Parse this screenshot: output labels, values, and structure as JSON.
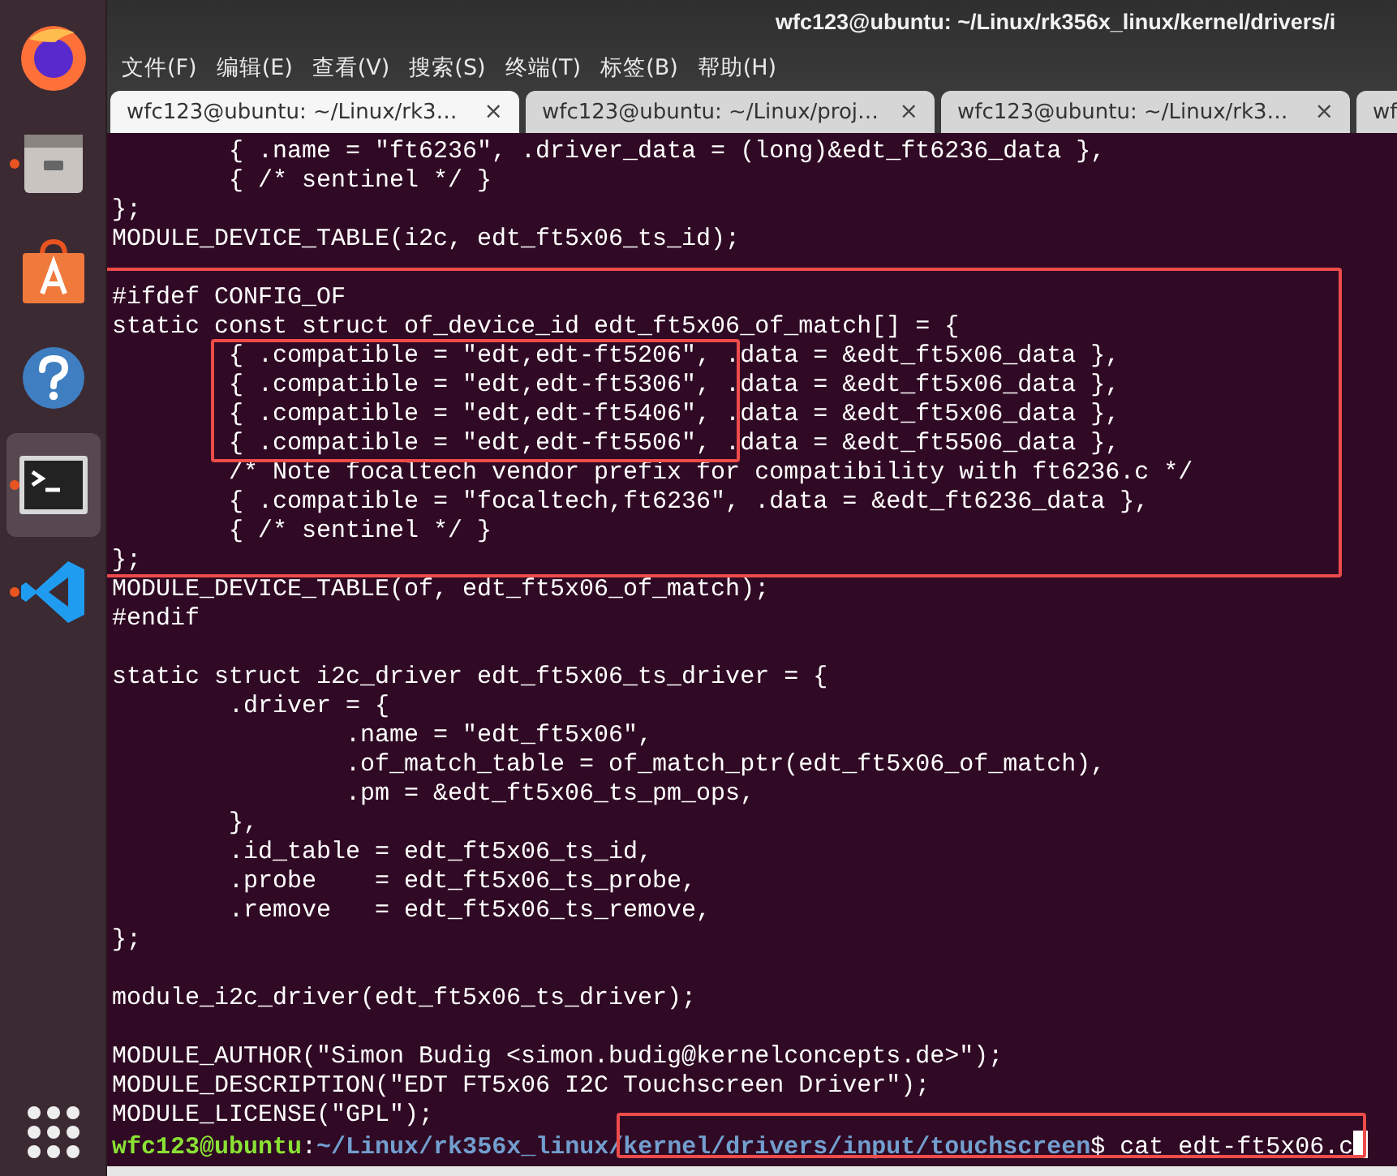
{
  "dock": {
    "items": [
      {
        "kind": "firefox",
        "running": false,
        "selected": false
      },
      {
        "kind": "files",
        "running": true,
        "selected": false
      },
      {
        "kind": "store",
        "running": false,
        "selected": false
      },
      {
        "kind": "help",
        "running": false,
        "selected": false
      },
      {
        "kind": "terminal",
        "running": true,
        "selected": true
      },
      {
        "kind": "vscode",
        "running": true,
        "selected": false
      }
    ]
  },
  "window": {
    "title": "wfc123@ubuntu: ~/Linux/rk356x_linux/kernel/drivers/i"
  },
  "menu": [
    "文件(F)",
    "编辑(E)",
    "查看(V)",
    "搜索(S)",
    "终端(T)",
    "标签(B)",
    "帮助(H)"
  ],
  "tabs": [
    {
      "label": "wfc123@ubuntu: ~/Linux/rk3…",
      "selected": true,
      "close": "×"
    },
    {
      "label": "wfc123@ubuntu: ~/Linux/proj…",
      "selected": false,
      "close": "×"
    },
    {
      "label": "wfc123@ubuntu: ~/Linux/rk3…",
      "selected": false,
      "close": "×"
    },
    {
      "label": "wf",
      "selected": false
    }
  ],
  "terminal": {
    "lines": [
      {
        "text": "        { .name = \"ft6236\", .driver_data = (long)&edt_ft6236_data },"
      },
      {
        "text": "        { /* sentinel */ }"
      },
      {
        "text": "};"
      },
      {
        "text": "MODULE_DEVICE_TABLE(i2c, edt_ft5x06_ts_id);"
      },
      {
        "kind": "blank"
      },
      {
        "text": "#ifdef CONFIG_OF"
      },
      {
        "text": "static const struct of_device_id edt_ft5x06_of_match[] = {"
      },
      {
        "text": "        { .compatible = \"edt,edt-ft5206\", .data = &edt_ft5x06_data },"
      },
      {
        "text": "        { .compatible = \"edt,edt-ft5306\", .data = &edt_ft5x06_data },"
      },
      {
        "text": "        { .compatible = \"edt,edt-ft5406\", .data = &edt_ft5x06_data },"
      },
      {
        "text": "        { .compatible = \"edt,edt-ft5506\", .data = &edt_ft5506_data },"
      },
      {
        "text": "        /* Note focaltech vendor prefix for compatibility with ft6236.c */"
      },
      {
        "text": "        { .compatible = \"focaltech,ft6236\", .data = &edt_ft6236_data },"
      },
      {
        "text": "        { /* sentinel */ }"
      },
      {
        "text": "};"
      },
      {
        "text": "MODULE_DEVICE_TABLE(of, edt_ft5x06_of_match);"
      },
      {
        "text": "#endif"
      },
      {
        "kind": "blank"
      },
      {
        "text": "static struct i2c_driver edt_ft5x06_ts_driver = {"
      },
      {
        "text": "        .driver = {"
      },
      {
        "text": "                .name = \"edt_ft5x06\","
      },
      {
        "text": "                .of_match_table = of_match_ptr(edt_ft5x06_of_match),"
      },
      {
        "text": "                .pm = &edt_ft5x06_ts_pm_ops,"
      },
      {
        "text": "        },"
      },
      {
        "text": "        .id_table = edt_ft5x06_ts_id,"
      },
      {
        "text": "        .probe    = edt_ft5x06_ts_probe,"
      },
      {
        "text": "        .remove   = edt_ft5x06_ts_remove,"
      },
      {
        "text": "};"
      },
      {
        "kind": "blank"
      },
      {
        "text": "module_i2c_driver(edt_ft5x06_ts_driver);"
      },
      {
        "kind": "blank"
      },
      {
        "text": "MODULE_AUTHOR(\"Simon Budig <simon.budig@kernelconcepts.de>\");"
      },
      {
        "text": "MODULE_DESCRIPTION(\"EDT FT5x06 I2C Touchscreen Driver\");"
      },
      {
        "text": "MODULE_LICENSE(\"GPL\");"
      },
      {
        "kind": "prompt",
        "user": "wfc123@ubuntu",
        "sep": ":",
        "path": "~/Linux/rk356x_linux/kernel/drivers/input/touchscreen",
        "command": "$ cat edt-ft5x06.c"
      }
    ]
  }
}
